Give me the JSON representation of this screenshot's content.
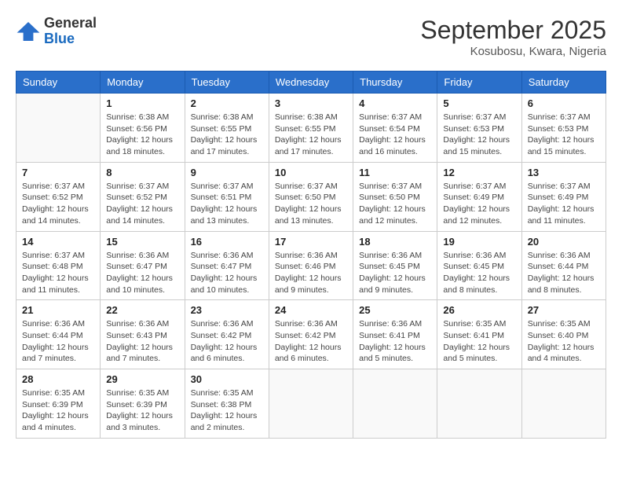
{
  "logo": {
    "general": "General",
    "blue": "Blue"
  },
  "header": {
    "month": "September 2025",
    "location": "Kosubosu, Kwara, Nigeria"
  },
  "days_of_week": [
    "Sunday",
    "Monday",
    "Tuesday",
    "Wednesday",
    "Thursday",
    "Friday",
    "Saturday"
  ],
  "weeks": [
    [
      {
        "day": "",
        "info": ""
      },
      {
        "day": "1",
        "info": "Sunrise: 6:38 AM\nSunset: 6:56 PM\nDaylight: 12 hours\nand 18 minutes."
      },
      {
        "day": "2",
        "info": "Sunrise: 6:38 AM\nSunset: 6:55 PM\nDaylight: 12 hours\nand 17 minutes."
      },
      {
        "day": "3",
        "info": "Sunrise: 6:38 AM\nSunset: 6:55 PM\nDaylight: 12 hours\nand 17 minutes."
      },
      {
        "day": "4",
        "info": "Sunrise: 6:37 AM\nSunset: 6:54 PM\nDaylight: 12 hours\nand 16 minutes."
      },
      {
        "day": "5",
        "info": "Sunrise: 6:37 AM\nSunset: 6:53 PM\nDaylight: 12 hours\nand 15 minutes."
      },
      {
        "day": "6",
        "info": "Sunrise: 6:37 AM\nSunset: 6:53 PM\nDaylight: 12 hours\nand 15 minutes."
      }
    ],
    [
      {
        "day": "7",
        "info": "Sunrise: 6:37 AM\nSunset: 6:52 PM\nDaylight: 12 hours\nand 14 minutes."
      },
      {
        "day": "8",
        "info": "Sunrise: 6:37 AM\nSunset: 6:52 PM\nDaylight: 12 hours\nand 14 minutes."
      },
      {
        "day": "9",
        "info": "Sunrise: 6:37 AM\nSunset: 6:51 PM\nDaylight: 12 hours\nand 13 minutes."
      },
      {
        "day": "10",
        "info": "Sunrise: 6:37 AM\nSunset: 6:50 PM\nDaylight: 12 hours\nand 13 minutes."
      },
      {
        "day": "11",
        "info": "Sunrise: 6:37 AM\nSunset: 6:50 PM\nDaylight: 12 hours\nand 12 minutes."
      },
      {
        "day": "12",
        "info": "Sunrise: 6:37 AM\nSunset: 6:49 PM\nDaylight: 12 hours\nand 12 minutes."
      },
      {
        "day": "13",
        "info": "Sunrise: 6:37 AM\nSunset: 6:49 PM\nDaylight: 12 hours\nand 11 minutes."
      }
    ],
    [
      {
        "day": "14",
        "info": "Sunrise: 6:37 AM\nSunset: 6:48 PM\nDaylight: 12 hours\nand 11 minutes."
      },
      {
        "day": "15",
        "info": "Sunrise: 6:36 AM\nSunset: 6:47 PM\nDaylight: 12 hours\nand 10 minutes."
      },
      {
        "day": "16",
        "info": "Sunrise: 6:36 AM\nSunset: 6:47 PM\nDaylight: 12 hours\nand 10 minutes."
      },
      {
        "day": "17",
        "info": "Sunrise: 6:36 AM\nSunset: 6:46 PM\nDaylight: 12 hours\nand 9 minutes."
      },
      {
        "day": "18",
        "info": "Sunrise: 6:36 AM\nSunset: 6:45 PM\nDaylight: 12 hours\nand 9 minutes."
      },
      {
        "day": "19",
        "info": "Sunrise: 6:36 AM\nSunset: 6:45 PM\nDaylight: 12 hours\nand 8 minutes."
      },
      {
        "day": "20",
        "info": "Sunrise: 6:36 AM\nSunset: 6:44 PM\nDaylight: 12 hours\nand 8 minutes."
      }
    ],
    [
      {
        "day": "21",
        "info": "Sunrise: 6:36 AM\nSunset: 6:44 PM\nDaylight: 12 hours\nand 7 minutes."
      },
      {
        "day": "22",
        "info": "Sunrise: 6:36 AM\nSunset: 6:43 PM\nDaylight: 12 hours\nand 7 minutes."
      },
      {
        "day": "23",
        "info": "Sunrise: 6:36 AM\nSunset: 6:42 PM\nDaylight: 12 hours\nand 6 minutes."
      },
      {
        "day": "24",
        "info": "Sunrise: 6:36 AM\nSunset: 6:42 PM\nDaylight: 12 hours\nand 6 minutes."
      },
      {
        "day": "25",
        "info": "Sunrise: 6:36 AM\nSunset: 6:41 PM\nDaylight: 12 hours\nand 5 minutes."
      },
      {
        "day": "26",
        "info": "Sunrise: 6:35 AM\nSunset: 6:41 PM\nDaylight: 12 hours\nand 5 minutes."
      },
      {
        "day": "27",
        "info": "Sunrise: 6:35 AM\nSunset: 6:40 PM\nDaylight: 12 hours\nand 4 minutes."
      }
    ],
    [
      {
        "day": "28",
        "info": "Sunrise: 6:35 AM\nSunset: 6:39 PM\nDaylight: 12 hours\nand 4 minutes."
      },
      {
        "day": "29",
        "info": "Sunrise: 6:35 AM\nSunset: 6:39 PM\nDaylight: 12 hours\nand 3 minutes."
      },
      {
        "day": "30",
        "info": "Sunrise: 6:35 AM\nSunset: 6:38 PM\nDaylight: 12 hours\nand 2 minutes."
      },
      {
        "day": "",
        "info": ""
      },
      {
        "day": "",
        "info": ""
      },
      {
        "day": "",
        "info": ""
      },
      {
        "day": "",
        "info": ""
      }
    ]
  ]
}
